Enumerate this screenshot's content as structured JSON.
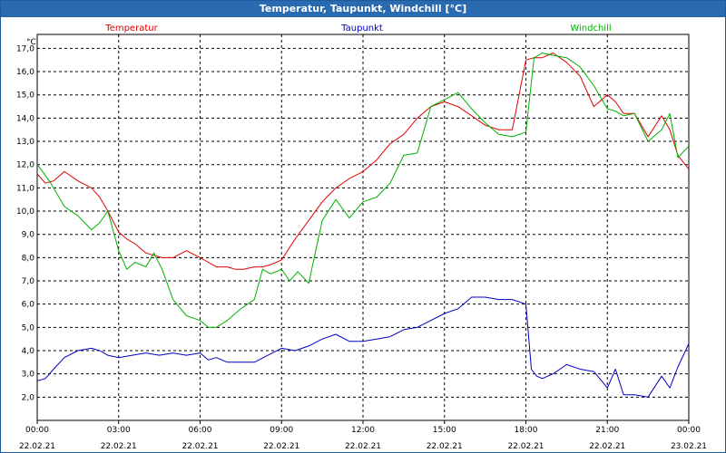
{
  "window": {
    "title": "Temperatur, Taupunkt, Windchill [°C]"
  },
  "chart_data": {
    "type": "line",
    "title": "Temperatur, Taupunkt, Windchill [°C]",
    "unit_label": "°C",
    "x_unit": "hours since 22.02.21 00:00",
    "xlim": [
      0,
      24
    ],
    "ylim": [
      1.0,
      17.6
    ],
    "grid": true,
    "legend_placement": "top",
    "x_ticks": [
      {
        "time": "00:00",
        "date": "22.02.21"
      },
      {
        "time": "03:00",
        "date": "22.02.21"
      },
      {
        "time": "06:00",
        "date": "22.02.21"
      },
      {
        "time": "09:00",
        "date": "22.02.21"
      },
      {
        "time": "12:00",
        "date": "22.02.21"
      },
      {
        "time": "15:00",
        "date": "22.02.21"
      },
      {
        "time": "18:00",
        "date": "22.02.21"
      },
      {
        "time": "21:00",
        "date": "22.02.21"
      },
      {
        "time": "00:00",
        "date": "23.02.21"
      }
    ],
    "y_ticks": [
      "2,0",
      "3,0",
      "4,0",
      "5,0",
      "6,0",
      "7,0",
      "8,0",
      "9,0",
      "10,0",
      "11,0",
      "12,0",
      "13,0",
      "14,0",
      "15,0",
      "16,0",
      "17,0"
    ],
    "series": [
      {
        "name": "Temperatur",
        "color": "#e00000",
        "x": [
          0,
          0.3,
          0.6,
          1,
          1.5,
          2,
          2.3,
          2.6,
          3,
          3.3,
          3.6,
          4,
          4.3,
          4.6,
          5,
          5.5,
          6,
          6.3,
          6.6,
          7,
          7.3,
          7.6,
          8,
          8.3,
          8.6,
          9,
          9.5,
          10,
          10.5,
          11,
          11.5,
          12,
          12.5,
          13,
          13.5,
          14,
          14.5,
          15,
          15.5,
          16,
          16.5,
          17,
          17.5,
          18,
          18.3,
          18.6,
          19,
          19.5,
          20,
          20.5,
          21,
          21.3,
          21.6,
          22,
          22.5,
          23,
          23.3,
          23.6,
          24
        ],
        "y": [
          11.6,
          11.2,
          11.3,
          11.7,
          11.3,
          11,
          10.6,
          10,
          9.1,
          8.8,
          8.6,
          8.2,
          8.1,
          8,
          8,
          8.3,
          8,
          7.8,
          7.6,
          7.6,
          7.5,
          7.5,
          7.6,
          7.6,
          7.7,
          7.9,
          8.8,
          9.6,
          10.4,
          11,
          11.4,
          11.7,
          12.2,
          12.9,
          13.3,
          14,
          14.5,
          14.7,
          14.5,
          14.1,
          13.7,
          13.5,
          13.5,
          16.5,
          16.6,
          16.6,
          16.8,
          16.4,
          15.8,
          14.5,
          15,
          14.7,
          14.2,
          14.2,
          13.2,
          14.1,
          13.5,
          12.4,
          11.8
        ]
      },
      {
        "name": "Taupunkt",
        "color": "#0000c0",
        "x": [
          0,
          0.3,
          0.6,
          1,
          1.5,
          2,
          2.3,
          2.6,
          3,
          3.5,
          4,
          4.5,
          5,
          5.5,
          6,
          6.3,
          6.6,
          7,
          7.5,
          8,
          8.5,
          9,
          9.5,
          10,
          10.5,
          11,
          11.5,
          12,
          12.5,
          13,
          13.5,
          14,
          14.5,
          15,
          15.5,
          16,
          16.5,
          17,
          17.5,
          18,
          18.2,
          18.4,
          18.6,
          19,
          19.5,
          20,
          20.5,
          21,
          21.3,
          21.6,
          22,
          22.5,
          23,
          23.3,
          23.6,
          24
        ],
        "y": [
          2.7,
          2.8,
          3.2,
          3.7,
          4,
          4.1,
          4,
          3.8,
          3.7,
          3.8,
          3.9,
          3.8,
          3.9,
          3.8,
          3.9,
          3.6,
          3.7,
          3.5,
          3.5,
          3.5,
          3.8,
          4.1,
          4,
          4.2,
          4.5,
          4.7,
          4.4,
          4.4,
          4.5,
          4.6,
          4.9,
          5,
          5.3,
          5.6,
          5.8,
          6.3,
          6.3,
          6.2,
          6.2,
          6,
          3.2,
          2.9,
          2.8,
          3,
          3.4,
          3.2,
          3.1,
          2.4,
          3.2,
          2.1,
          2.1,
          2,
          2.9,
          2.4,
          3.3,
          4.3
        ]
      },
      {
        "name": "Windchill",
        "color": "#00b000",
        "x": [
          0,
          0.2,
          0.5,
          1,
          1.5,
          2,
          2.3,
          2.6,
          3,
          3.3,
          3.6,
          4,
          4.3,
          4.6,
          5,
          5.5,
          6,
          6.3,
          6.6,
          7,
          7.5,
          8,
          8.3,
          8.6,
          9,
          9.3,
          9.6,
          10,
          10.5,
          11,
          11.5,
          12,
          12.5,
          13,
          13.5,
          14,
          14.5,
          15,
          15.5,
          16,
          16.5,
          17,
          17.5,
          18,
          18.3,
          18.6,
          19,
          19.5,
          20,
          20.5,
          21,
          21.3,
          21.6,
          22,
          22.5,
          23,
          23.3,
          23.6,
          24
        ],
        "y": [
          12,
          11.7,
          11.2,
          10.2,
          9.8,
          9.2,
          9.5,
          10,
          8.3,
          7.5,
          7.8,
          7.6,
          8.2,
          7.5,
          6.2,
          5.5,
          5.3,
          5,
          5,
          5.3,
          5.8,
          6.2,
          7.5,
          7.3,
          7.5,
          7,
          7.4,
          6.9,
          9.6,
          10.5,
          9.7,
          10.4,
          10.6,
          11.2,
          12.4,
          12.5,
          14.5,
          14.8,
          15.1,
          14.4,
          13.8,
          13.3,
          13.2,
          13.4,
          16.6,
          16.8,
          16.7,
          16.6,
          16.2,
          15.4,
          14.4,
          14.3,
          14.1,
          14.2,
          13,
          13.5,
          14.2,
          12.3,
          12.8
        ]
      }
    ]
  }
}
